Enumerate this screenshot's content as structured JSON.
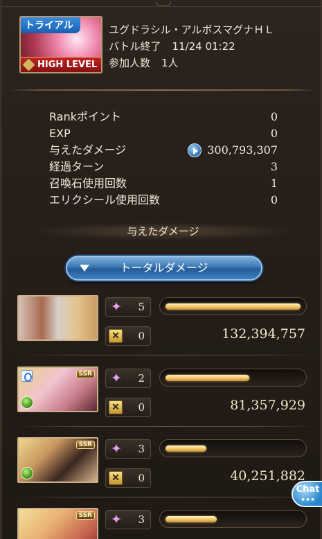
{
  "quest": {
    "trial_tag": "トライアル",
    "level_badge": "HIGH LEVEL",
    "name": "ユグドラシル・アルボスマグナＨＬ",
    "battle_end_label": "バトル終了",
    "battle_end_time": "11/24 01:22",
    "participants_label": "参加人数",
    "participants_value": "1人"
  },
  "stats": [
    {
      "label": "Rankポイント",
      "value": "0"
    },
    {
      "label": "EXP",
      "value": "0"
    },
    {
      "label": "与えたダメージ",
      "value": "300,793,307"
    },
    {
      "label": "経過ターン",
      "value": "3"
    },
    {
      "label": "召喚石使用回数",
      "value": "1"
    },
    {
      "label": "エリクシール使用回数",
      "value": "0"
    }
  ],
  "damage_section": {
    "title": "与えたダメージ",
    "total_button": "トータルダメージ"
  },
  "members": [
    {
      "count_a": "5",
      "count_b": "0",
      "damage": "132,394,757",
      "bar_fraction": 1.0,
      "ssr": "",
      "element": "none"
    },
    {
      "count_a": "2",
      "count_b": "0",
      "damage": "81,357,929",
      "bar_fraction": 0.62,
      "ssr": "SSR",
      "element": "wind"
    },
    {
      "count_a": "3",
      "count_b": "0",
      "damage": "40,251,882",
      "bar_fraction": 0.3,
      "ssr": "SSR",
      "element": "wind"
    },
    {
      "count_a": "3",
      "count_b": "",
      "damage": "",
      "bar_fraction": 0.38,
      "ssr": "SSR",
      "element": "fire"
    }
  ],
  "chat": {
    "label": "Chat",
    "dots": "•••"
  },
  "icons": {
    "star": "star-icon",
    "sword": "sword-icon",
    "play": "play-icon",
    "chevron": "chevron-down-icon"
  }
}
